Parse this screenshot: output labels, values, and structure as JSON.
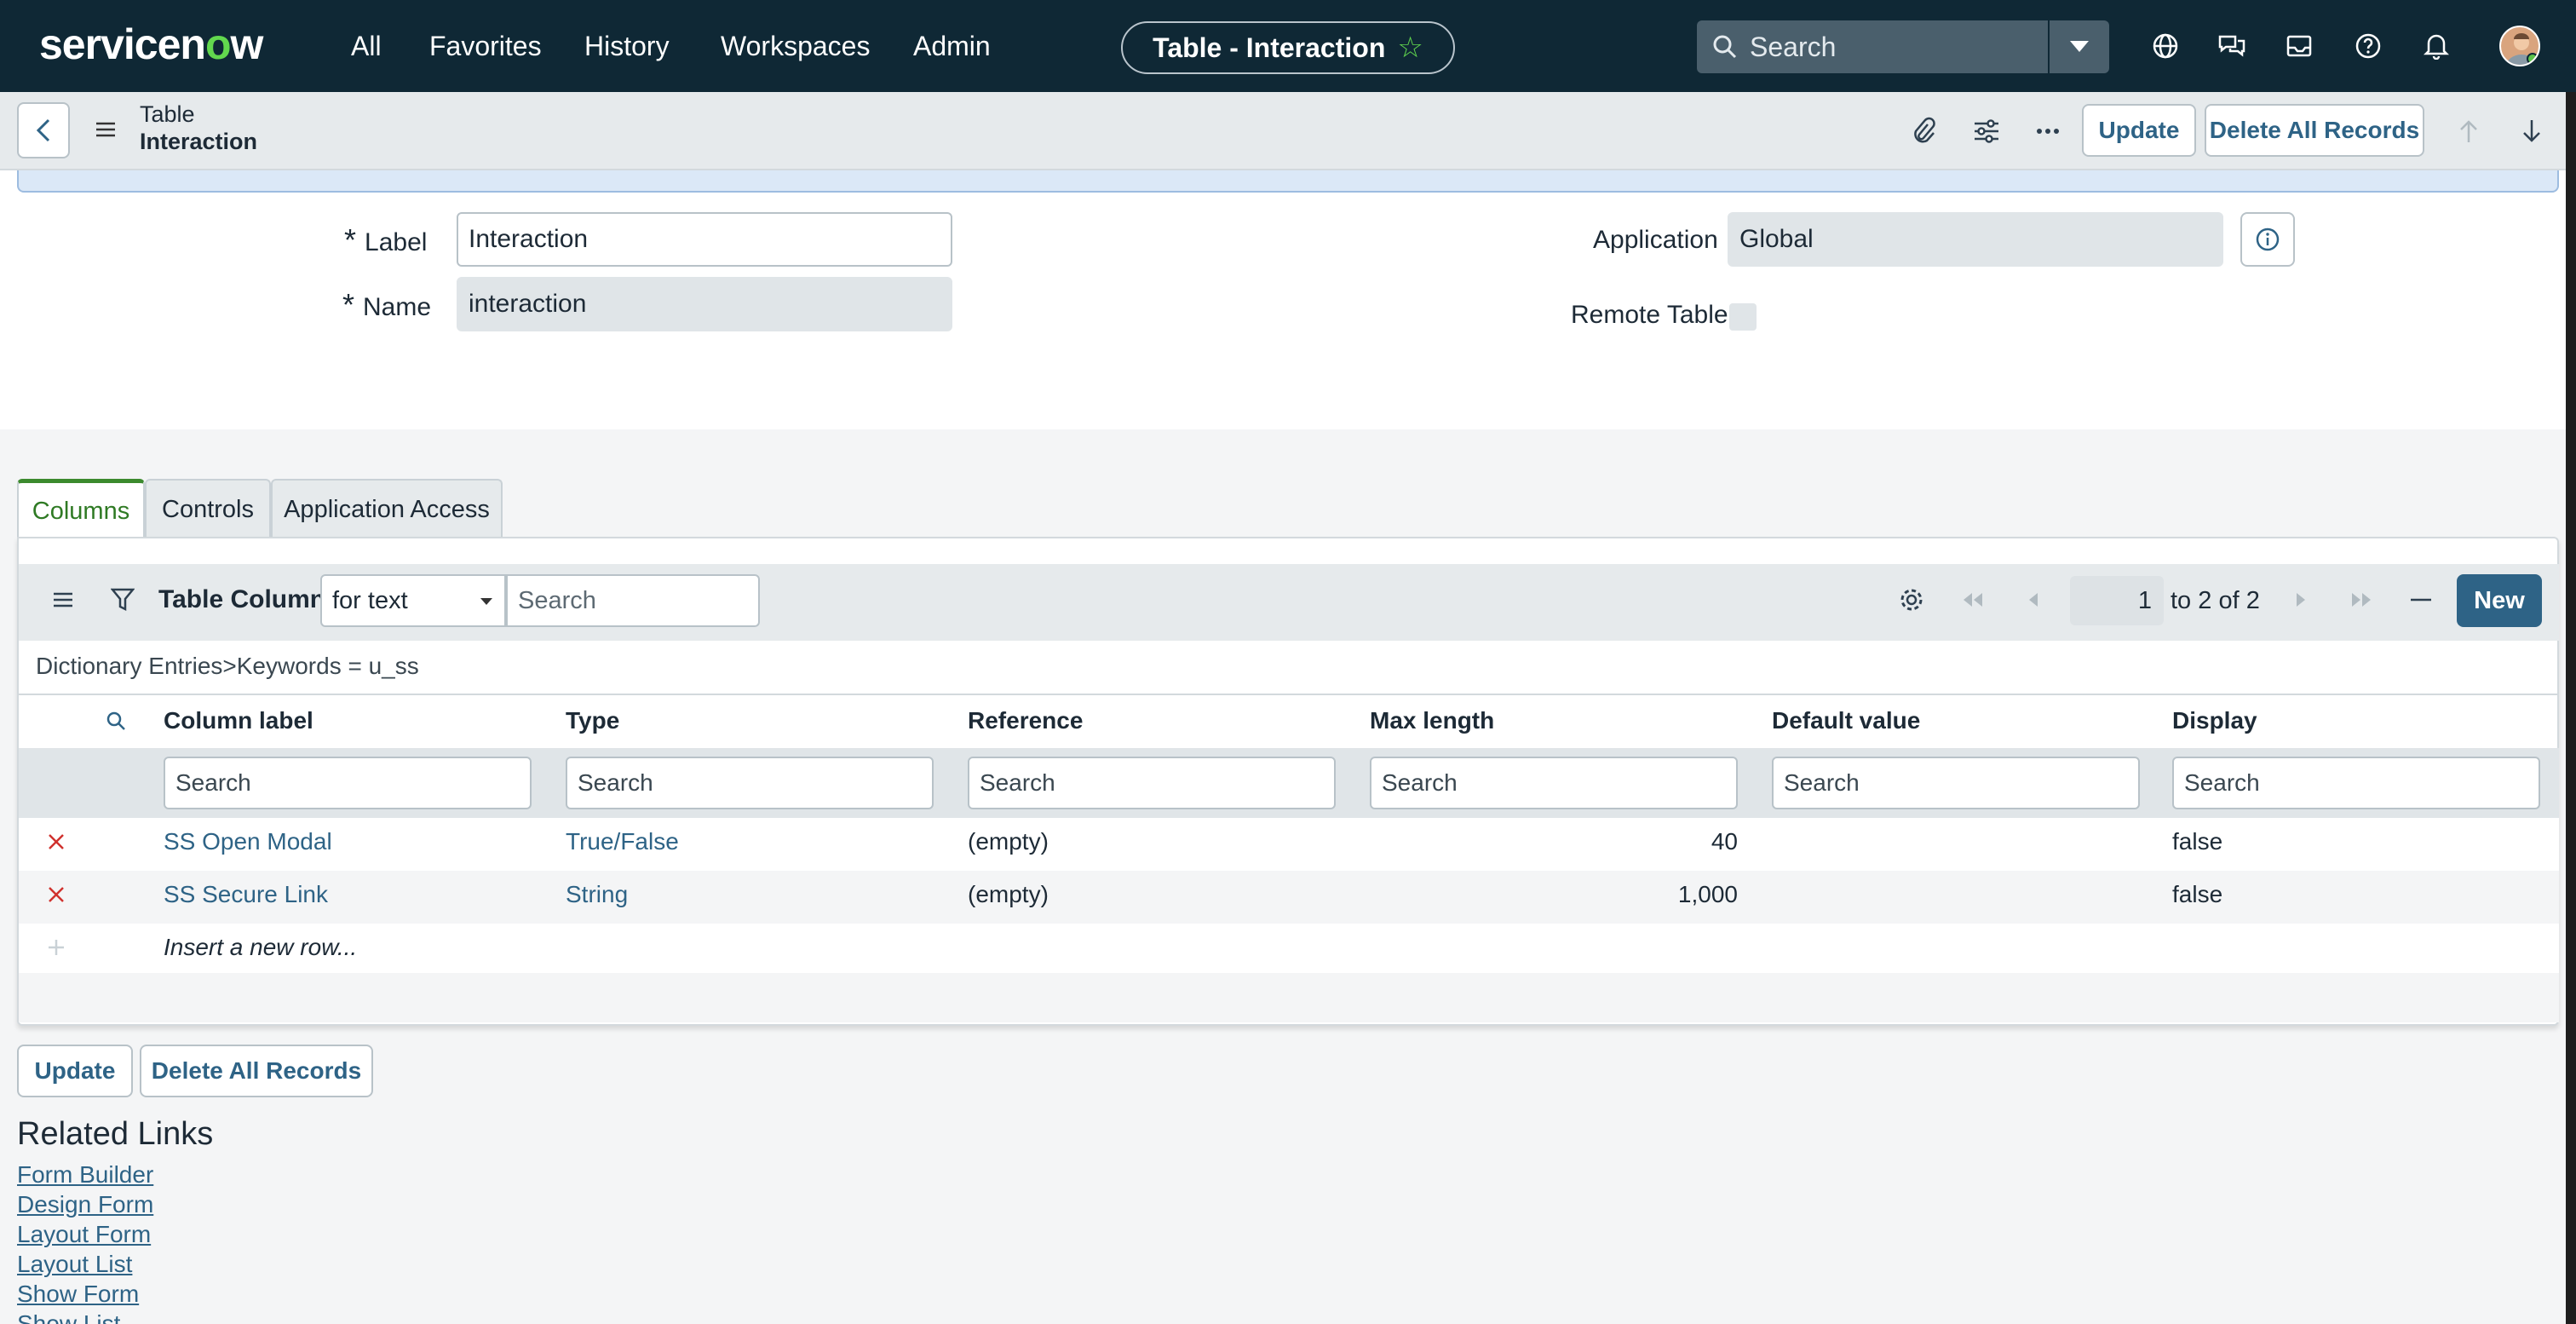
{
  "nav": {
    "logo_prefix": "servicen",
    "logo_o": "o",
    "logo_suffix": "w",
    "items": [
      "All",
      "Favorites",
      "History",
      "Workspaces",
      "Admin"
    ],
    "context_title": "Table - Interaction",
    "search_placeholder": "Search",
    "icons": [
      "globe-icon",
      "chat-icon",
      "inbox-icon",
      "help-icon",
      "bell-icon"
    ]
  },
  "form_header": {
    "title_line1": "Table",
    "title_line2": "Interaction",
    "update_label": "Update",
    "delete_all_label": "Delete All Records"
  },
  "form": {
    "label_label": "Label",
    "label_value": "Interaction",
    "name_label": "Name",
    "name_value": "interaction",
    "application_label": "Application",
    "application_value": "Global",
    "remote_table_label": "Remote Table"
  },
  "tabs": [
    "Columns",
    "Controls",
    "Application Access"
  ],
  "list": {
    "title": "Table Columns",
    "filter_select": "for text",
    "search_placeholder": "Search",
    "page_current": "1",
    "page_to": "to",
    "page_end": "2",
    "page_of": "of",
    "page_total": "2",
    "new_label": "New",
    "breadcrumb": "Dictionary Entries>Keywords = u_ss",
    "columns": [
      "Column label",
      "Type",
      "Reference",
      "Max length",
      "Default value",
      "Display"
    ],
    "column_search_placeholder": "Search",
    "rows": [
      {
        "label": "SS Open Modal",
        "type": "True/False",
        "reference": "(empty)",
        "max_length": "40",
        "default_value": "",
        "display": "false"
      },
      {
        "label": "SS Secure Link",
        "type": "String",
        "reference": "(empty)",
        "max_length": "1,000",
        "default_value": "",
        "display": "false"
      }
    ],
    "insert_row": "Insert a new row..."
  },
  "bottom_buttons": {
    "update": "Update",
    "delete_all": "Delete All Records"
  },
  "related_links": {
    "title": "Related Links",
    "links": [
      "Form Builder",
      "Design Form",
      "Layout Form",
      "Layout List",
      "Show Form",
      "Show List"
    ]
  },
  "colors": {
    "nav_bg": "#0f2835",
    "accent_green": "#62d84e",
    "link_blue": "#2e6386",
    "delete_red": "#d0312d"
  }
}
